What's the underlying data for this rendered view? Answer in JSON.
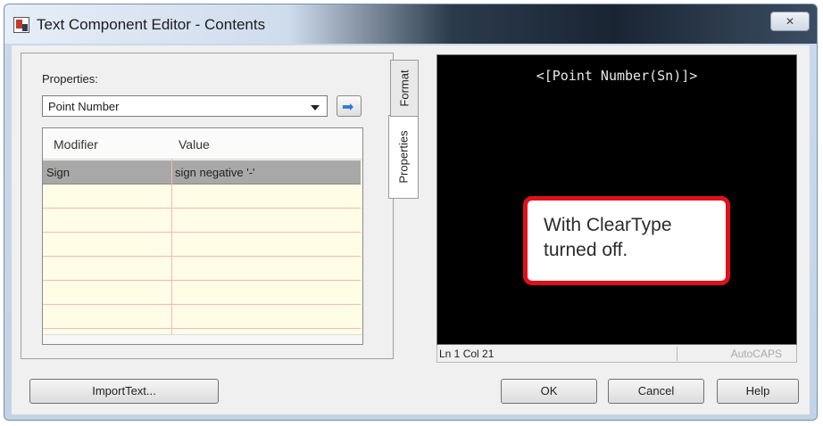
{
  "window": {
    "title": "Text Component Editor - Contents",
    "close_label": "✕"
  },
  "properties": {
    "label": "Properties:",
    "selected": "Point Number",
    "go_arrow": "➡"
  },
  "grid": {
    "headers": {
      "modifier": "Modifier",
      "value": "Value"
    },
    "rows": [
      {
        "modifier": "Sign",
        "value": "sign negative '-'"
      }
    ]
  },
  "tabs": [
    {
      "label": "Properties"
    },
    {
      "label": "Format"
    }
  ],
  "preview": {
    "code": "<[Point Number(Sn)]>",
    "callout": "With ClearType\nturned off."
  },
  "status": {
    "position": "Ln 1 Col 21",
    "caps": "AutoCAPS"
  },
  "buttons": {
    "import": "ImportText...",
    "ok": "OK",
    "cancel": "Cancel",
    "help": "Help"
  },
  "colors": {
    "callout_border": "#e0101a",
    "grid_bg": "#fffde6",
    "selected_row": "#a8a8a8"
  },
  "icons": {
    "app": "text-editor-icon",
    "go": "arrow-right-icon",
    "dropdown": "chevron-down-icon"
  }
}
